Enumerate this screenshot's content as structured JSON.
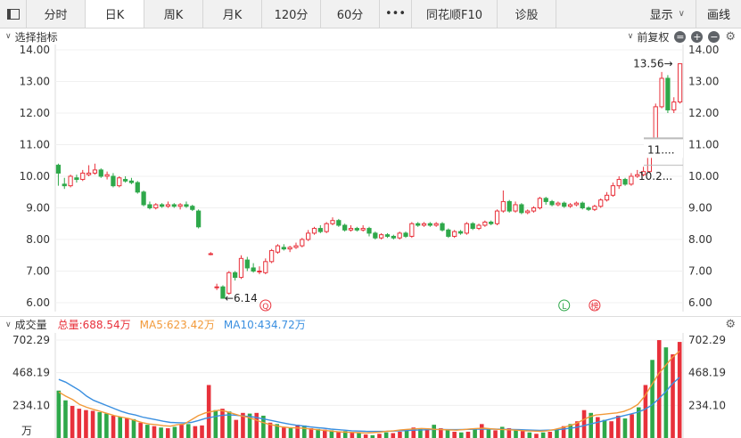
{
  "tabs": [
    {
      "label": ""
    },
    {
      "label": "分时"
    },
    {
      "label": "日K"
    },
    {
      "label": "周K"
    },
    {
      "label": "月K"
    },
    {
      "label": "120分"
    },
    {
      "label": "60分"
    },
    {
      "label": "•••"
    },
    {
      "label": "同花顺F10"
    },
    {
      "label": "诊股"
    }
  ],
  "toolbar": {
    "display_label": "显示",
    "draw_label": "画线"
  },
  "kline_header": {
    "indicator_label": "选择指标",
    "adjust_label": "前复权"
  },
  "price_axis": {
    "ticks": [
      "14.00",
      "13.00",
      "12.00",
      "11.00",
      "10.00",
      "9.00",
      "8.00",
      "7.00",
      "6.00"
    ],
    "high_label": "13.56→",
    "low_label": "←6.14",
    "tag_upper": "11....",
    "tag_lower": "10.2...",
    "markers": [
      "Q",
      "L",
      "榜"
    ]
  },
  "volume_header": {
    "title": "成交量",
    "total": "总量:688.54万",
    "ma5": "MA5:623.42万",
    "ma10": "MA10:434.72万"
  },
  "volume_axis": {
    "ticks": [
      "702.29",
      "468.19",
      "234.10"
    ],
    "unit": "万"
  },
  "colors": {
    "up": "#e8313b",
    "down": "#2ea84a",
    "ma5": "#f29a3a",
    "ma10": "#3a8fe0"
  },
  "chart_data": {
    "type": "candlestick",
    "ylim": [
      6.0,
      14.0
    ],
    "candles": [
      [
        10.35,
        10.1,
        10.4,
        9.7
      ],
      [
        9.75,
        9.7,
        9.95,
        9.6
      ],
      [
        9.7,
        10.0,
        10.05,
        9.65
      ],
      [
        9.95,
        9.9,
        10.05,
        9.8
      ],
      [
        9.9,
        10.1,
        10.2,
        9.85
      ],
      [
        10.05,
        10.1,
        10.35,
        10.0
      ],
      [
        10.1,
        10.2,
        10.4,
        10.05
      ],
      [
        10.2,
        10.0,
        10.25,
        9.95
      ],
      [
        10.0,
        10.05,
        10.15,
        9.9
      ],
      [
        10.0,
        9.7,
        10.1,
        9.65
      ],
      [
        9.7,
        9.95,
        10.0,
        9.65
      ],
      [
        9.9,
        9.85,
        10.0,
        9.8
      ],
      [
        9.85,
        9.8,
        9.95,
        9.75
      ],
      [
        9.8,
        9.5,
        9.85,
        9.45
      ],
      [
        9.5,
        9.1,
        9.55,
        9.05
      ],
      [
        9.1,
        9.0,
        9.2,
        8.95
      ],
      [
        9.0,
        9.1,
        9.15,
        8.95
      ],
      [
        9.1,
        9.05,
        9.15,
        9.0
      ],
      [
        9.05,
        9.1,
        9.2,
        9.0
      ],
      [
        9.1,
        9.05,
        9.15,
        9.0
      ],
      [
        9.05,
        9.1,
        9.15,
        8.95
      ],
      [
        9.1,
        9.05,
        9.2,
        9.0
      ],
      [
        9.05,
        8.95,
        9.1,
        8.9
      ],
      [
        8.9,
        8.4,
        8.95,
        8.35
      ],
      [
        null,
        null,
        null,
        null
      ],
      [
        7.55,
        7.55,
        7.6,
        7.5
      ],
      [
        6.5,
        6.5,
        6.6,
        6.4
      ],
      [
        6.5,
        6.14,
        6.55,
        6.14
      ],
      [
        6.3,
        6.95,
        7.0,
        6.25
      ],
      [
        6.95,
        6.8,
        7.0,
        6.7
      ],
      [
        6.8,
        7.4,
        7.5,
        6.75
      ],
      [
        7.35,
        7.1,
        7.45,
        7.0
      ],
      [
        7.1,
        7.0,
        7.25,
        6.95
      ],
      [
        7.0,
        7.0,
        7.15,
        6.9
      ],
      [
        6.95,
        7.3,
        7.4,
        6.9
      ],
      [
        7.3,
        7.65,
        7.7,
        7.25
      ],
      [
        7.6,
        7.8,
        7.85,
        7.55
      ],
      [
        7.75,
        7.7,
        7.85,
        7.65
      ],
      [
        7.7,
        7.75,
        7.8,
        7.6
      ],
      [
        7.75,
        7.8,
        7.9,
        7.7
      ],
      [
        7.8,
        8.0,
        8.05,
        7.75
      ],
      [
        8.0,
        8.2,
        8.3,
        7.95
      ],
      [
        8.2,
        8.35,
        8.4,
        8.15
      ],
      [
        8.35,
        8.25,
        8.45,
        8.2
      ],
      [
        8.25,
        8.5,
        8.55,
        8.2
      ],
      [
        8.5,
        8.6,
        8.7,
        8.45
      ],
      [
        8.6,
        8.45,
        8.65,
        8.4
      ],
      [
        8.45,
        8.3,
        8.5,
        8.25
      ],
      [
        8.3,
        8.35,
        8.45,
        8.25
      ],
      [
        8.35,
        8.3,
        8.4,
        8.25
      ],
      [
        8.3,
        8.35,
        8.45,
        8.25
      ],
      [
        8.35,
        8.2,
        8.4,
        8.1
      ],
      [
        8.2,
        8.05,
        8.25,
        8.0
      ],
      [
        8.05,
        8.15,
        8.2,
        8.0
      ],
      [
        8.15,
        8.1,
        8.2,
        8.05
      ],
      [
        8.1,
        8.05,
        8.15,
        8.0
      ],
      [
        8.05,
        8.2,
        8.25,
        8.0
      ],
      [
        8.2,
        8.1,
        8.25,
        8.05
      ],
      [
        8.1,
        8.5,
        8.55,
        8.05
      ],
      [
        8.5,
        8.45,
        8.55,
        8.4
      ],
      [
        8.45,
        8.5,
        8.55,
        8.4
      ],
      [
        8.5,
        8.45,
        8.55,
        8.4
      ],
      [
        8.45,
        8.5,
        8.55,
        8.4
      ],
      [
        8.5,
        8.3,
        8.55,
        8.25
      ],
      [
        8.3,
        8.1,
        8.35,
        8.05
      ],
      [
        8.1,
        8.25,
        8.3,
        8.05
      ],
      [
        8.25,
        8.2,
        8.3,
        8.15
      ],
      [
        8.2,
        8.5,
        8.55,
        8.15
      ],
      [
        8.5,
        8.35,
        8.55,
        8.3
      ],
      [
        8.35,
        8.45,
        8.5,
        8.3
      ],
      [
        8.45,
        8.55,
        8.6,
        8.4
      ],
      [
        8.55,
        8.5,
        8.6,
        8.45
      ],
      [
        8.5,
        8.9,
        8.95,
        8.45
      ],
      [
        8.9,
        9.2,
        9.55,
        8.85
      ],
      [
        9.2,
        8.9,
        9.25,
        8.85
      ],
      [
        8.9,
        9.1,
        9.2,
        8.85
      ],
      [
        9.1,
        8.85,
        9.15,
        8.8
      ],
      [
        8.85,
        8.9,
        8.95,
        8.8
      ],
      [
        8.9,
        9.0,
        9.05,
        8.85
      ],
      [
        9.0,
        9.3,
        9.35,
        8.95
      ],
      [
        9.3,
        9.2,
        9.35,
        9.1
      ],
      [
        9.2,
        9.1,
        9.25,
        9.05
      ],
      [
        9.1,
        9.15,
        9.2,
        9.05
      ],
      [
        9.15,
        9.05,
        9.2,
        9.0
      ],
      [
        9.05,
        9.1,
        9.15,
        9.0
      ],
      [
        9.1,
        9.15,
        9.2,
        9.05
      ],
      [
        9.15,
        9.0,
        9.2,
        8.95
      ],
      [
        9.0,
        8.95,
        9.05,
        8.9
      ],
      [
        8.95,
        9.05,
        9.1,
        8.9
      ],
      [
        9.05,
        9.25,
        9.3,
        9.0
      ],
      [
        9.25,
        9.4,
        9.5,
        9.2
      ],
      [
        9.4,
        9.7,
        9.8,
        9.35
      ],
      [
        9.7,
        9.9,
        10.0,
        9.6
      ],
      [
        9.9,
        9.75,
        9.95,
        9.7
      ],
      [
        9.75,
        10.0,
        10.1,
        9.7
      ],
      [
        10.0,
        10.05,
        10.2,
        9.95
      ],
      [
        10.05,
        10.15,
        10.3,
        10.0
      ],
      [
        10.15,
        11.1,
        11.2,
        10.1
      ],
      [
        11.1,
        12.2,
        12.3,
        11.05
      ],
      [
        12.2,
        13.1,
        13.3,
        12.15
      ],
      [
        13.1,
        12.1,
        13.2,
        12.0
      ],
      [
        12.1,
        12.35,
        12.5,
        12.0
      ],
      [
        12.35,
        13.56,
        13.56,
        12.3
      ]
    ],
    "volumes": [
      [
        340,
        0
      ],
      [
        270,
        0
      ],
      [
        230,
        1
      ],
      [
        210,
        1
      ],
      [
        200,
        1
      ],
      [
        195,
        1
      ],
      [
        185,
        0
      ],
      [
        175,
        0
      ],
      [
        160,
        1
      ],
      [
        150,
        0
      ],
      [
        140,
        1
      ],
      [
        135,
        0
      ],
      [
        110,
        1
      ],
      [
        95,
        0
      ],
      [
        85,
        1
      ],
      [
        75,
        0
      ],
      [
        70,
        1
      ],
      [
        80,
        0
      ],
      [
        95,
        1
      ],
      [
        100,
        0
      ],
      [
        85,
        1
      ],
      [
        90,
        1
      ],
      [
        380,
        1
      ],
      [
        200,
        0
      ],
      [
        210,
        1
      ],
      [
        190,
        0
      ],
      [
        130,
        1
      ],
      [
        180,
        1
      ],
      [
        175,
        0
      ],
      [
        180,
        1
      ],
      [
        160,
        0
      ],
      [
        110,
        1
      ],
      [
        100,
        0
      ],
      [
        75,
        1
      ],
      [
        70,
        0
      ],
      [
        95,
        1
      ],
      [
        90,
        0
      ],
      [
        70,
        1
      ],
      [
        65,
        0
      ],
      [
        60,
        1
      ],
      [
        55,
        0
      ],
      [
        45,
        1
      ],
      [
        50,
        0
      ],
      [
        40,
        1
      ],
      [
        35,
        0
      ],
      [
        25,
        1
      ],
      [
        20,
        0
      ],
      [
        30,
        1
      ],
      [
        40,
        0
      ],
      [
        35,
        1
      ],
      [
        45,
        1
      ],
      [
        60,
        0
      ],
      [
        75,
        1
      ],
      [
        65,
        0
      ],
      [
        70,
        1
      ],
      [
        95,
        0
      ],
      [
        70,
        1
      ],
      [
        60,
        0
      ],
      [
        45,
        1
      ],
      [
        40,
        0
      ],
      [
        45,
        1
      ],
      [
        65,
        0
      ],
      [
        100,
        1
      ],
      [
        70,
        0
      ],
      [
        55,
        1
      ],
      [
        80,
        0
      ],
      [
        70,
        1
      ],
      [
        60,
        0
      ],
      [
        50,
        1
      ],
      [
        40,
        0
      ],
      [
        30,
        1
      ],
      [
        40,
        0
      ],
      [
        45,
        1
      ],
      [
        60,
        0
      ],
      [
        85,
        1
      ],
      [
        100,
        0
      ],
      [
        120,
        1
      ],
      [
        200,
        1
      ],
      [
        180,
        0
      ],
      [
        150,
        1
      ],
      [
        130,
        0
      ],
      [
        120,
        1
      ],
      [
        160,
        1
      ],
      [
        140,
        0
      ],
      [
        170,
        1
      ],
      [
        220,
        0
      ],
      [
        380,
        1
      ],
      [
        560,
        0
      ],
      [
        702,
        1
      ],
      [
        650,
        0
      ],
      [
        600,
        1
      ],
      [
        689,
        1
      ]
    ],
    "ma5": [
      330,
      300,
      275,
      240,
      220,
      205,
      190,
      175,
      160,
      150,
      140,
      125,
      110,
      100,
      95,
      88,
      85,
      95,
      100,
      130,
      160,
      180,
      190,
      200,
      190,
      175,
      160,
      150,
      135,
      115,
      100,
      90,
      80,
      75,
      72,
      70,
      65,
      60,
      55,
      50,
      45,
      42,
      40,
      38,
      36,
      38,
      42,
      48,
      52,
      58,
      62,
      65,
      68,
      66,
      62,
      60,
      58,
      56,
      60,
      65,
      68,
      70,
      66,
      62,
      60,
      58,
      55,
      52,
      50,
      48,
      52,
      60,
      72,
      85,
      100,
      125,
      150,
      165,
      170,
      175,
      180,
      190,
      210,
      240,
      300,
      380,
      460,
      520,
      580,
      623
    ],
    "ma10": [
      420,
      400,
      370,
      340,
      300,
      270,
      250,
      230,
      210,
      190,
      175,
      165,
      150,
      140,
      130,
      120,
      112,
      110,
      108,
      112,
      125,
      140,
      150,
      160,
      165,
      165,
      160,
      155,
      150,
      140,
      130,
      120,
      110,
      100,
      92,
      86,
      80,
      75,
      70,
      64,
      60,
      56,
      52,
      50,
      48,
      47,
      47,
      48,
      50,
      52,
      54,
      56,
      58,
      60,
      61,
      61,
      60,
      60,
      61,
      62,
      63,
      64,
      64,
      63,
      62,
      61,
      60,
      58,
      56,
      55,
      56,
      58,
      62,
      68,
      75,
      85,
      98,
      110,
      122,
      135,
      148,
      160,
      172,
      185,
      205,
      235,
      280,
      330,
      390,
      435
    ]
  }
}
